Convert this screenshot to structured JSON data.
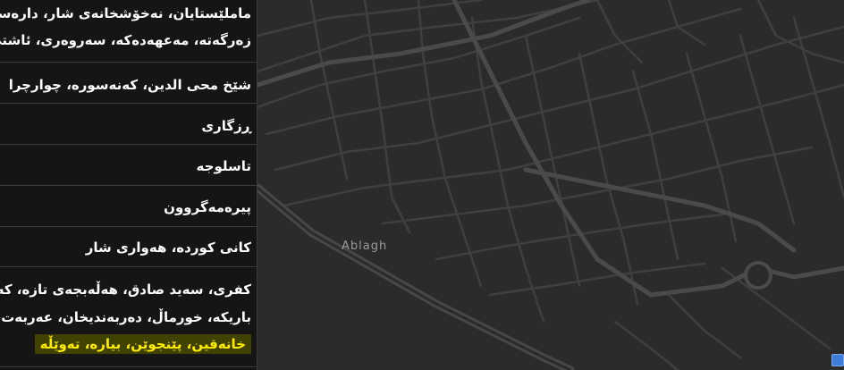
{
  "list": {
    "items": [
      {
        "lines": [
          "ماملێستایان، نەخۆشخانەی شار، دارەسوتاو",
          "زەرگەتە، مەعهەدەکە، سەروەری، ئاشتی،"
        ]
      },
      {
        "lines": [
          "شێخ محی الدین، کەنەسورە، چوارچرا"
        ]
      },
      {
        "lines": [
          "ڕزگاری"
        ]
      },
      {
        "lines": [
          "تاسلوجە"
        ]
      },
      {
        "lines": [
          "پیرەمەگروون"
        ]
      },
      {
        "lines": [
          "کانی کوردە، هەواری شار"
        ]
      },
      {
        "lines": [
          "کفری، سەید صادق، هەڵەبجەی تازە، کەلار",
          "باریکە، خورماڵ، دەربەندیخان، عەربەت، زەم"
        ],
        "highlight_line": "خانەقین، پێنجوێن، بیارە، تەوێڵە"
      }
    ]
  },
  "map": {
    "place_label": "Ablagh",
    "background_color": "#2b2b2b",
    "road_color": "#444444",
    "highway_color": "#4a4a4a"
  }
}
